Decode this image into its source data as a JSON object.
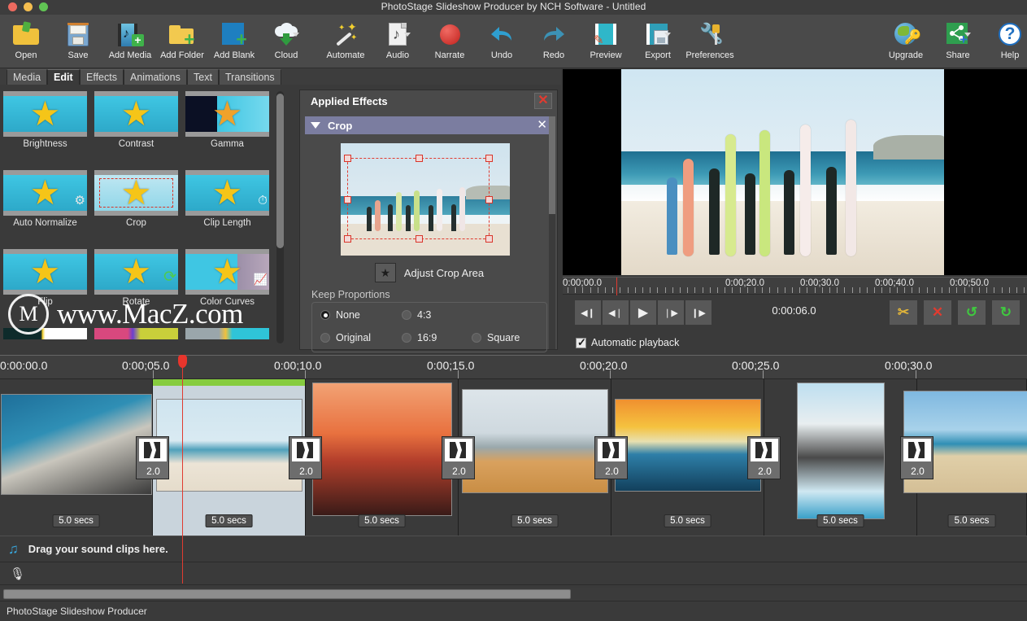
{
  "window": {
    "title": "PhotoStage Slideshow Producer by NCH Software - Untitled",
    "status": "PhotoStage Slideshow Producer"
  },
  "toolbar": {
    "left_buttons": [
      {
        "label": "Open",
        "icon": "open-folder-icon",
        "dropdown": false
      },
      {
        "label": "Save",
        "icon": "floppy-disk-icon",
        "dropdown": false
      },
      {
        "label": "Add Media",
        "icon": "add-media-icon",
        "dropdown": false
      },
      {
        "label": "Add Folder",
        "icon": "add-folder-icon",
        "dropdown": false
      },
      {
        "label": "Add Blank",
        "icon": "add-blank-icon",
        "dropdown": false
      },
      {
        "label": "Cloud",
        "icon": "cloud-download-icon",
        "dropdown": true
      }
    ],
    "mid_buttons": [
      {
        "label": "Automate",
        "icon": "magic-wand-icon",
        "dropdown": false
      },
      {
        "label": "Audio",
        "icon": "audio-file-icon",
        "dropdown": true
      },
      {
        "label": "Narrate",
        "icon": "record-circle-icon",
        "dropdown": false
      },
      {
        "label": "Undo",
        "icon": "undo-arrow-icon",
        "dropdown": false
      },
      {
        "label": "Redo",
        "icon": "redo-arrow-icon",
        "dropdown": false
      },
      {
        "label": "Preview",
        "icon": "preview-film-icon",
        "dropdown": false
      },
      {
        "label": "Export",
        "icon": "export-film-icon",
        "dropdown": true
      },
      {
        "label": "Preferences",
        "icon": "wrench-icon",
        "dropdown": false
      }
    ],
    "right_buttons": [
      {
        "label": "Upgrade",
        "icon": "globe-key-icon",
        "dropdown": false
      },
      {
        "label": "Share",
        "icon": "share-node-icon",
        "dropdown": true
      },
      {
        "label": "Help",
        "icon": "question-mark-icon",
        "dropdown": false
      }
    ]
  },
  "tabs": [
    {
      "label": "Media",
      "active": false
    },
    {
      "label": "Edit",
      "active": true
    },
    {
      "label": "Effects",
      "active": false
    },
    {
      "label": "Animations",
      "active": false
    },
    {
      "label": "Text",
      "active": false
    },
    {
      "label": "Transitions",
      "active": false
    }
  ],
  "effects_grid": [
    {
      "label": "Brightness",
      "icon": "star-film-icon"
    },
    {
      "label": "Contrast",
      "icon": "star-film-icon"
    },
    {
      "label": "Gamma",
      "icon": "star-film-red-icon"
    },
    {
      "label": "Auto Normalize",
      "icon": "star-gear-icon"
    },
    {
      "label": "Crop",
      "icon": "star-crop-icon"
    },
    {
      "label": "Clip Length",
      "icon": "star-clock-icon"
    },
    {
      "label": "Flip",
      "icon": "star-flip-icon"
    },
    {
      "label": "Rotate",
      "icon": "star-rotate-icon"
    },
    {
      "label": "Color Curves",
      "icon": "star-curves-icon"
    }
  ],
  "applied_effects": {
    "title": "Applied Effects",
    "close_icon": "close-x-icon",
    "effect": {
      "name": "Crop",
      "collapse_icon": "triangle-down-icon",
      "close_icon": "close-x-icon",
      "adjust_button_label": "Adjust Crop Area",
      "adjust_button_icon": "star-icon",
      "keep_proportions_label": "Keep Proportions",
      "options": [
        {
          "label": "None",
          "selected": true
        },
        {
          "label": "4:3",
          "selected": false
        },
        {
          "label": "Original",
          "selected": false
        },
        {
          "label": "16:9",
          "selected": false
        },
        {
          "label": "Square",
          "selected": false
        }
      ]
    }
  },
  "preview": {
    "scrubber_labels": [
      "0:00;00.0",
      "0:00;20.0",
      "0:00;30.0",
      "0:00;40.0",
      "0:00;50.0"
    ],
    "timecode": "0:00:06.0",
    "transport": [
      {
        "icon": "skip-to-start-icon",
        "name": "go-to-start"
      },
      {
        "icon": "step-back-icon",
        "name": "step-backward"
      },
      {
        "icon": "play-icon",
        "name": "play"
      },
      {
        "icon": "step-forward-icon",
        "name": "step-forward"
      },
      {
        "icon": "skip-to-end-icon",
        "name": "go-to-end"
      }
    ],
    "edit_buttons": [
      {
        "icon": "scissors-icon",
        "name": "split-clip"
      },
      {
        "icon": "red-x-icon",
        "name": "delete-clip"
      },
      {
        "icon": "rotate-left-icon",
        "name": "rotate-left"
      },
      {
        "icon": "rotate-right-icon",
        "name": "rotate-right"
      }
    ],
    "automatic_playback_label": "Automatic playback",
    "automatic_playback_checked": true
  },
  "timeline": {
    "ruler_labels": [
      "0:00:00.0",
      "0:00;05.0",
      "0:00;10.0",
      "0:00;15.0",
      "0:00;20.0",
      "0:00;25.0",
      "0:00;30.0"
    ],
    "clips": [
      {
        "duration": "5.0 secs",
        "selected": false,
        "scene": "boat-deck"
      },
      {
        "duration": "5.0 secs",
        "selected": true,
        "scene": "surfers-lineup"
      },
      {
        "duration": "5.0 secs",
        "selected": false,
        "scene": "sunset-silhouette"
      },
      {
        "duration": "5.0 secs",
        "selected": false,
        "scene": "two-surfers-beach"
      },
      {
        "duration": "5.0 secs",
        "selected": false,
        "scene": "wave-rider-sunset"
      },
      {
        "duration": "5.0 secs",
        "selected": false,
        "scene": "van-beach"
      },
      {
        "duration": "5.0 secs",
        "selected": false,
        "scene": "handstand-beach"
      }
    ],
    "transitions": [
      {
        "value": "2.0",
        "icon": "transition-icon"
      },
      {
        "value": "2.0",
        "icon": "transition-icon"
      },
      {
        "value": "2.0",
        "icon": "transition-icon"
      },
      {
        "value": "2.0",
        "icon": "transition-icon"
      },
      {
        "value": "2.0",
        "icon": "transition-icon"
      },
      {
        "value": "2.0",
        "icon": "transition-icon"
      }
    ]
  },
  "audio_track": {
    "placeholder": "Drag your sound clips here.",
    "icon": "music-note-icon"
  },
  "narration_track": {
    "icon": "microphone-icon"
  },
  "watermark": {
    "mark": "M",
    "text": "www.MacZ.com"
  },
  "colors": {
    "accent_blue": "#7b7da0",
    "playhead_red": "#e03b30",
    "selected_clip": "#c9d4dc",
    "green_bar": "#86cc3f",
    "toolbar_bg": "#4a4a4a",
    "panel_bg": "#3a3a3a"
  }
}
